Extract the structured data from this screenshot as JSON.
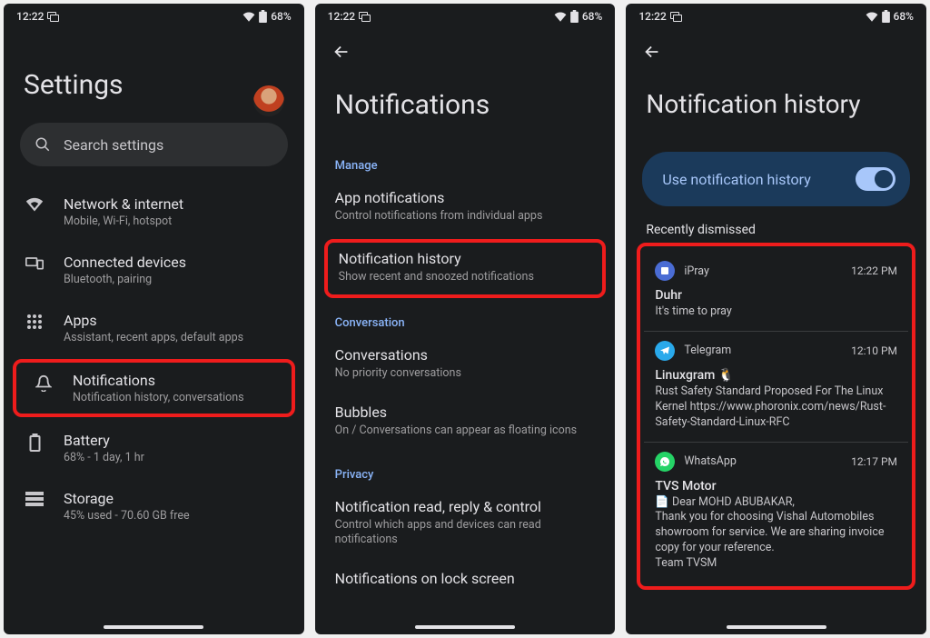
{
  "status": {
    "time": "12:22",
    "battery": "68%"
  },
  "screen1": {
    "title": "Settings",
    "search_placeholder": "Search settings",
    "items": [
      {
        "icon": "wifi",
        "title": "Network & internet",
        "sub": "Mobile, Wi-Fi, hotspot"
      },
      {
        "icon": "devices",
        "title": "Connected devices",
        "sub": "Bluetooth, pairing"
      },
      {
        "icon": "apps",
        "title": "Apps",
        "sub": "Assistant, recent apps, default apps"
      },
      {
        "icon": "bell",
        "title": "Notifications",
        "sub": "Notification history, conversations",
        "highlight": true
      },
      {
        "icon": "battery",
        "title": "Battery",
        "sub": "68% - 1 day, 1 hr"
      },
      {
        "icon": "storage",
        "title": "Storage",
        "sub": "45% used - 70.60 GB free"
      }
    ]
  },
  "screen2": {
    "title": "Notifications",
    "sections": [
      {
        "label": "Manage",
        "items": [
          {
            "title": "App notifications",
            "sub": "Control notifications from individual apps"
          },
          {
            "title": "Notification history",
            "sub": "Show recent and snoozed notifications",
            "highlight": true
          }
        ]
      },
      {
        "label": "Conversation",
        "items": [
          {
            "title": "Conversations",
            "sub": "No priority conversations"
          },
          {
            "title": "Bubbles",
            "sub": "On / Conversations can appear as floating icons"
          }
        ]
      },
      {
        "label": "Privacy",
        "items": [
          {
            "title": "Notification read, reply & control",
            "sub": "Control which apps and devices can read notifications"
          },
          {
            "title": "Notifications on lock screen",
            "sub": ""
          }
        ]
      }
    ]
  },
  "screen3": {
    "title": "Notification history",
    "toggle_label": "Use notification history",
    "subheader": "Recently dismissed",
    "cards": [
      {
        "app": "iPray",
        "icon": "ipray",
        "time": "12:22 PM",
        "title": "Duhr",
        "body": "It's time to pray"
      },
      {
        "app": "Telegram",
        "icon": "tg",
        "time": "12:10 PM",
        "title": "Linuxgram 🐧",
        "body": "Rust Safety Standard Proposed For The Linux Kernel https://www.phoronix.com/news/Rust-Safety-Standard-Linux-RFC"
      },
      {
        "app": "WhatsApp",
        "icon": "wa",
        "time": "12:17 PM",
        "title": "TVS Motor",
        "body": "📄 Dear MOHD ABUBAKAR,\nThank you for choosing Vishal Automobiles showroom for service. We are sharing invoice copy for your reference.\nTeam TVSM"
      }
    ]
  }
}
